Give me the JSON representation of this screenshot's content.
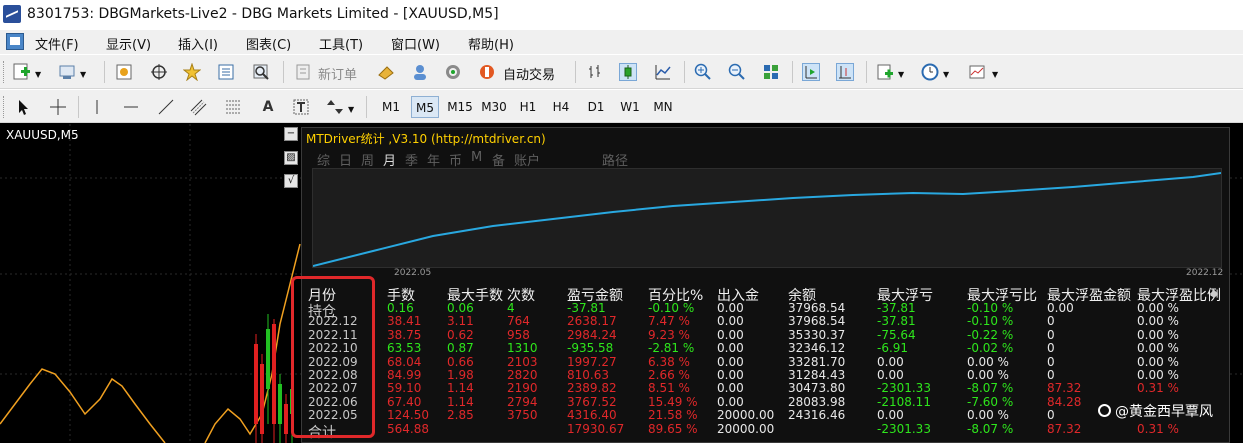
{
  "window": {
    "title": "8301753: DBGMarkets-Live2 - DBG Markets Limited - [XAUUSD,M5]"
  },
  "menu": [
    {
      "label": "文件(F)"
    },
    {
      "label": "显示(V)"
    },
    {
      "label": "插入(I)"
    },
    {
      "label": "图表(C)"
    },
    {
      "label": "工具(T)"
    },
    {
      "label": "窗口(W)"
    },
    {
      "label": "帮助(H)"
    }
  ],
  "toolbar": {
    "new_order_label": "新订单",
    "auto_trade_label": "自动交易"
  },
  "timeframes": [
    "M1",
    "M5",
    "M15",
    "M30",
    "H1",
    "H4",
    "D1",
    "W1",
    "MN"
  ],
  "active_timeframe": "M5",
  "chart": {
    "symbol": "XAUUSD,M5"
  },
  "panel": {
    "title": "MTDriver统计 ,V3.10 (http://mtdriver.cn)",
    "tabs": [
      {
        "label": "综"
      },
      {
        "label": "日"
      },
      {
        "label": "周"
      },
      {
        "label": "月"
      },
      {
        "label": "季"
      },
      {
        "label": "年"
      },
      {
        "label": "币"
      },
      {
        "label": "M"
      },
      {
        "label": "备"
      },
      {
        "label": "账户"
      },
      {
        "label": "路径"
      }
    ],
    "active_tab": "月",
    "equity_axis": {
      "start": "2022.05",
      "end": "2022.12"
    },
    "columns": [
      "月份",
      "手数",
      "最大手数",
      "次数",
      "盈亏金额",
      "百分比%",
      "出入金",
      "余额",
      "最大浮亏",
      "最大浮亏比",
      "最大浮盈金额",
      "最大浮盈比例"
    ],
    "rows": [
      {
        "month": "持仓",
        "lots": "0.16",
        "max_lots": "0.06",
        "count": "4",
        "pnl": "-37.81",
        "pct": "-0.10 %",
        "cash": "0.00",
        "balance": "37968.54",
        "max_loss": "-37.81",
        "max_loss_pct": "-0.10 %",
        "max_profit": "0.00",
        "max_profit_pct": "0.00 %"
      },
      {
        "month": "2022.12",
        "lots": "38.41",
        "max_lots": "3.11",
        "count": "764",
        "pnl": "2638.17",
        "pct": "7.47 %",
        "cash": "0.00",
        "balance": "37968.54",
        "max_loss": "-37.81",
        "max_loss_pct": "-0.10 %",
        "max_profit": "0",
        "max_profit_pct": "0.00 %"
      },
      {
        "month": "2022.11",
        "lots": "38.75",
        "max_lots": "0.62",
        "count": "958",
        "pnl": "2984.24",
        "pct": "9.23 %",
        "cash": "0.00",
        "balance": "35330.37",
        "max_loss": "-75.64",
        "max_loss_pct": "-0.22 %",
        "max_profit": "0",
        "max_profit_pct": "0.00 %"
      },
      {
        "month": "2022.10",
        "lots": "63.53",
        "max_lots": "0.87",
        "count": "1310",
        "pnl": "-935.58",
        "pct": "-2.81 %",
        "cash": "0.00",
        "balance": "32346.12",
        "max_loss": "-6.91",
        "max_loss_pct": "-0.02 %",
        "max_profit": "0",
        "max_profit_pct": "0.00 %"
      },
      {
        "month": "2022.09",
        "lots": "68.04",
        "max_lots": "0.66",
        "count": "2103",
        "pnl": "1997.27",
        "pct": "6.38 %",
        "cash": "0.00",
        "balance": "33281.70",
        "max_loss": "0.00",
        "max_loss_pct": "0.00 %",
        "max_profit": "0",
        "max_profit_pct": "0.00 %"
      },
      {
        "month": "2022.08",
        "lots": "84.99",
        "max_lots": "1.98",
        "count": "2820",
        "pnl": "810.63",
        "pct": "2.66 %",
        "cash": "0.00",
        "balance": "31284.43",
        "max_loss": "0.00",
        "max_loss_pct": "0.00 %",
        "max_profit": "0",
        "max_profit_pct": "0.00 %"
      },
      {
        "month": "2022.07",
        "lots": "59.10",
        "max_lots": "1.14",
        "count": "2190",
        "pnl": "2389.82",
        "pct": "8.51 %",
        "cash": "0.00",
        "balance": "30473.80",
        "max_loss": "-2301.33",
        "max_loss_pct": "-8.07 %",
        "max_profit": "87.32",
        "max_profit_pct": "0.31 %"
      },
      {
        "month": "2022.06",
        "lots": "67.40",
        "max_lots": "1.14",
        "count": "2794",
        "pnl": "3767.52",
        "pct": "15.49 %",
        "cash": "0.00",
        "balance": "28083.98",
        "max_loss": "-2108.11",
        "max_loss_pct": "-7.60 %",
        "max_profit": "84.28",
        "max_profit_pct": ""
      },
      {
        "month": "2022.05",
        "lots": "124.50",
        "max_lots": "2.85",
        "count": "3750",
        "pnl": "4316.40",
        "pct": "21.58 %",
        "cash": "20000.00",
        "balance": "24316.46",
        "max_loss": "0.00",
        "max_loss_pct": "0.00 %",
        "max_profit": "0",
        "max_profit_pct": ""
      },
      {
        "month": "合计",
        "lots": "564.88",
        "max_lots": "",
        "count": "",
        "pnl": "17930.67",
        "pct": "89.65 %",
        "cash": "20000.00",
        "balance": "",
        "max_loss": "-2301.33",
        "max_loss_pct": "-8.07 %",
        "max_profit": "87.32",
        "max_profit_pct": "0.31 %"
      }
    ]
  },
  "watermark": {
    "text": "@黄金西早覃风"
  },
  "colors": {
    "panel_title": "#ffd000",
    "positive": "#e0282a",
    "negative": "#2ee61c",
    "equity_line": "#29a8e0",
    "highlight": "#e0282a"
  }
}
